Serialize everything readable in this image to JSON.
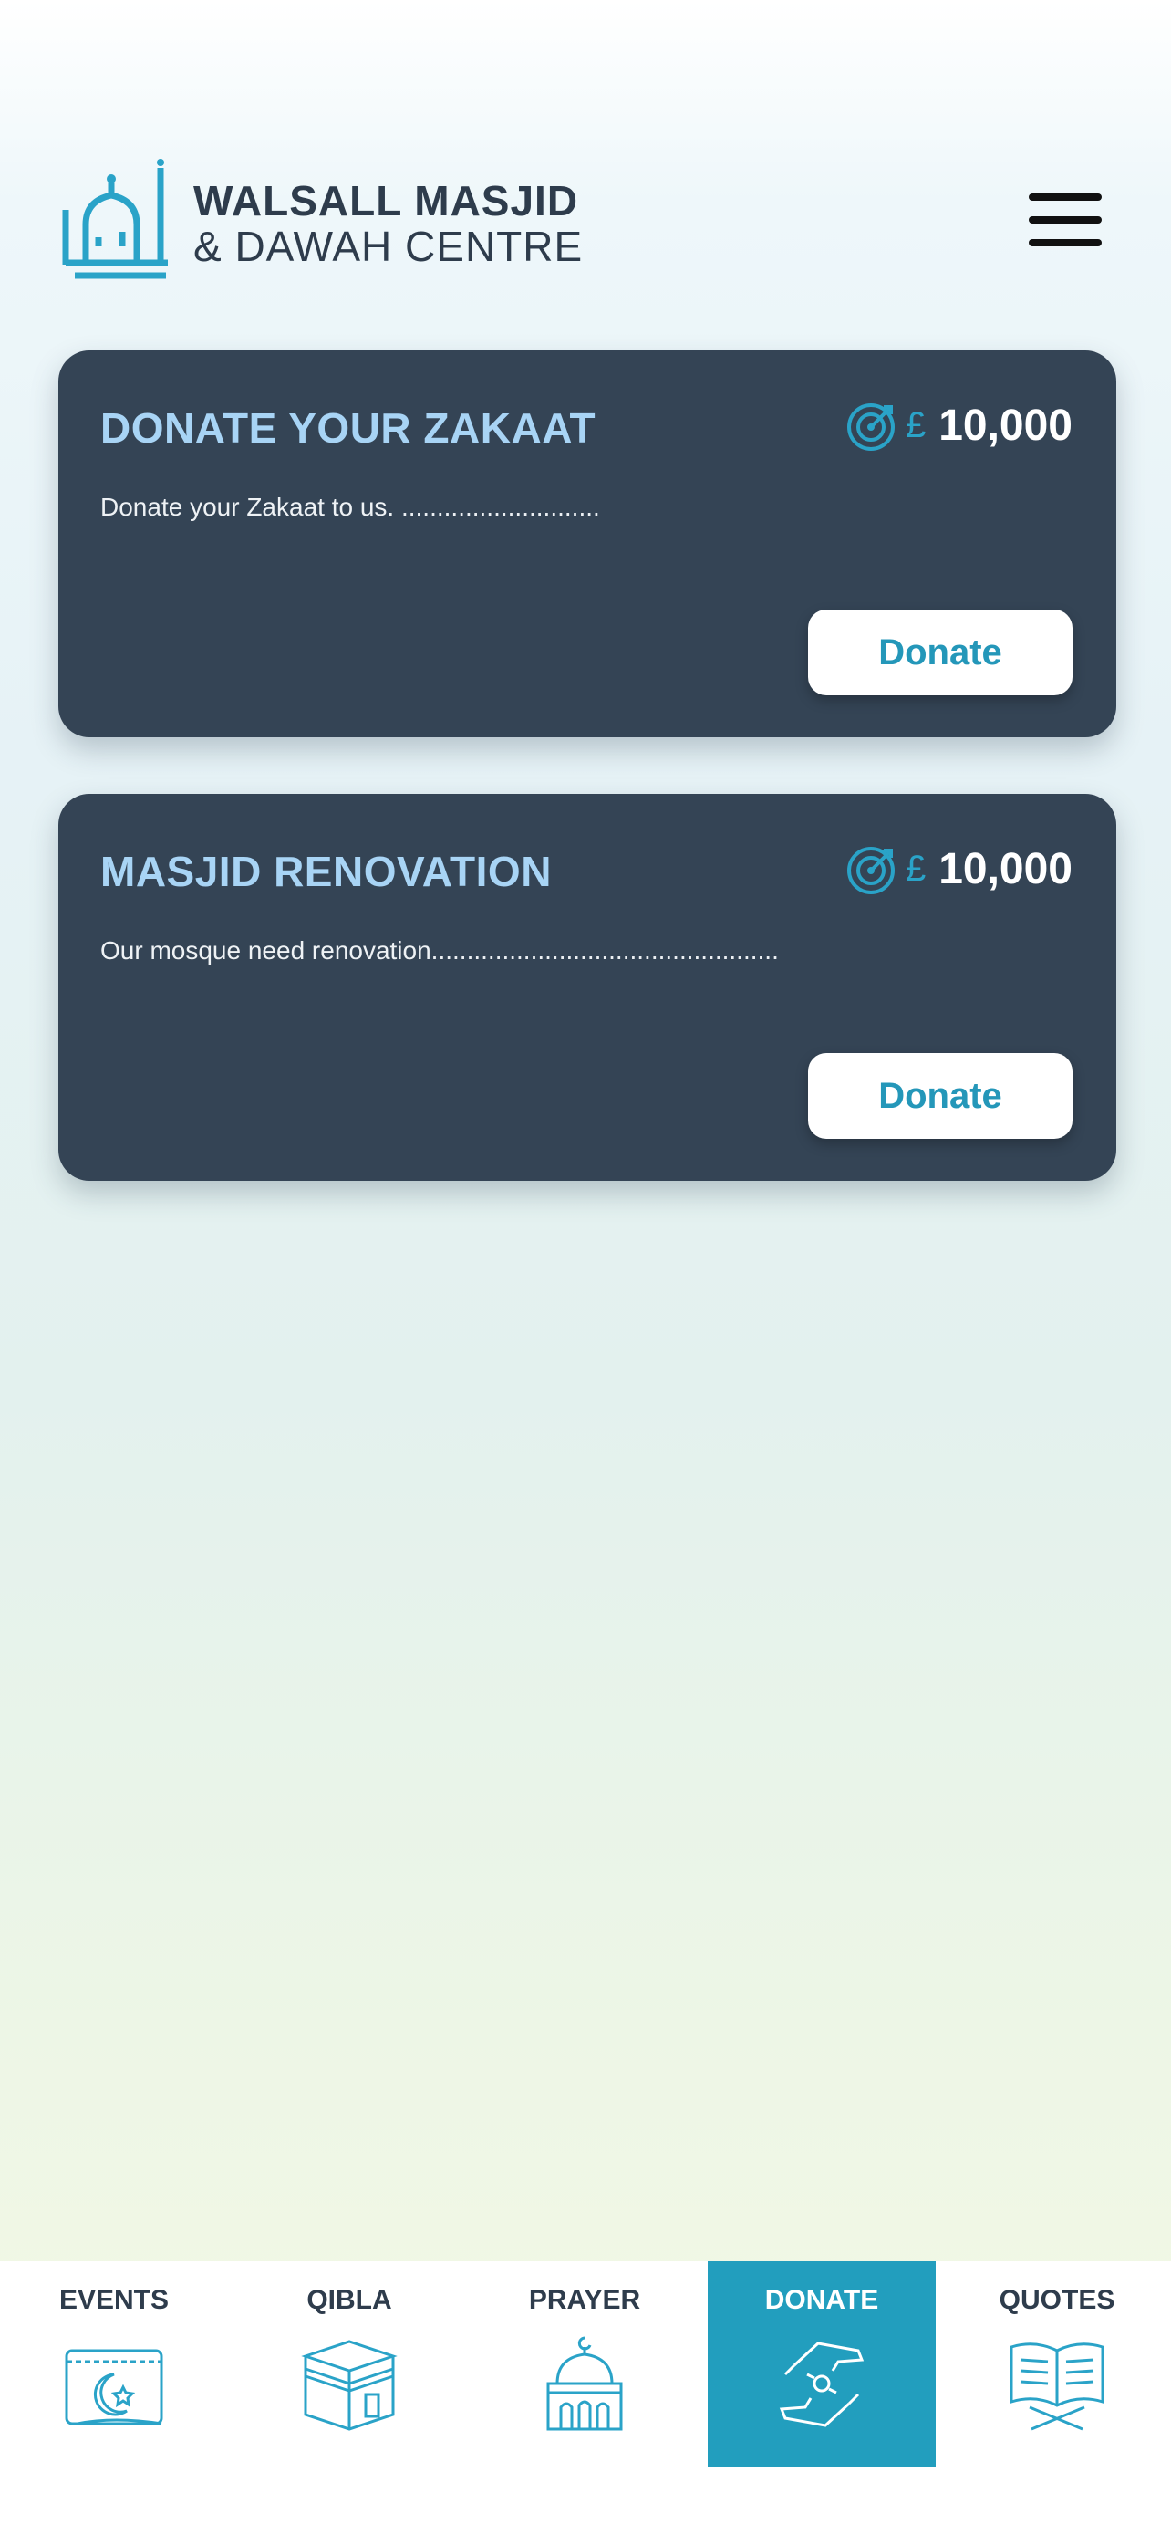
{
  "header": {
    "logo": {
      "line1": "WALSALL MASJID",
      "line2": "& DAWAH CENTRE",
      "icon": "mosque-calligraphy-logo"
    },
    "menu_icon": "hamburger-menu-icon"
  },
  "campaigns": [
    {
      "title": "DONATE YOUR ZAKAAT",
      "description": "Donate your Zakaat to us. ............................",
      "currency": "£",
      "goal": "10,000",
      "button_label": "Donate"
    },
    {
      "title": "MASJID RENOVATION",
      "description": "Our mosque need renovation.................................................",
      "currency": "£",
      "goal": "10,000",
      "button_label": "Donate"
    }
  ],
  "bottom_nav": {
    "items": [
      {
        "label": "EVENTS",
        "icon": "crescent-calendar-icon"
      },
      {
        "label": "QIBLA",
        "icon": "kaaba-icon"
      },
      {
        "label": "PRAYER",
        "icon": "mosque-icon"
      },
      {
        "label": "DONATE",
        "icon": "giving-hands-icon",
        "active": true
      },
      {
        "label": "QUOTES",
        "icon": "open-quran-icon"
      }
    ]
  },
  "colors": {
    "card_background": "#344455",
    "card_title": "#a8d4f5",
    "accent": "#229ebe",
    "logo_teal": "#2aa3c8",
    "text_dark": "#2e3c4c"
  }
}
